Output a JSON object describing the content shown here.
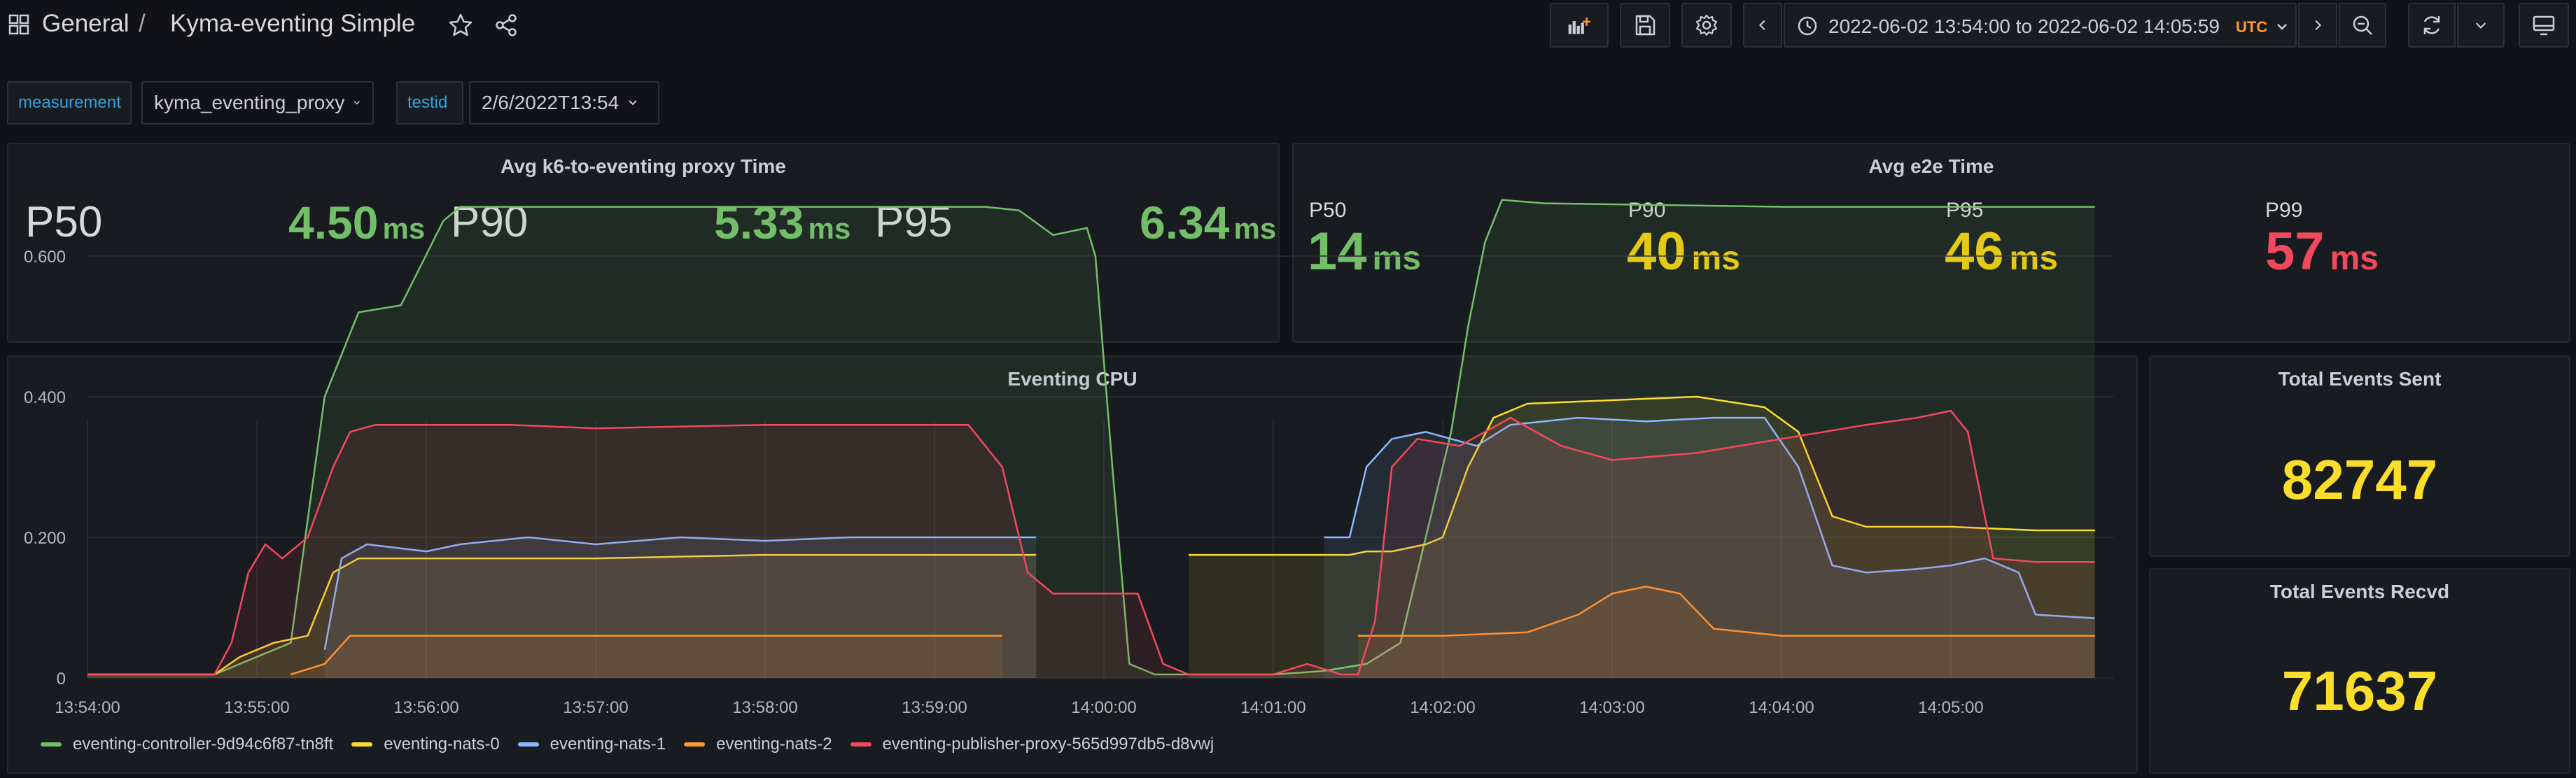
{
  "header": {
    "folder": "General",
    "separator": "/",
    "dashboard_title": "Kyma-eventing Simple",
    "time_range": "2022-06-02 13:54:00 to 2022-06-02 14:05:59",
    "timezone": "UTC"
  },
  "variables": [
    {
      "label": "measurement",
      "value": "kyma_eventing_proxy"
    },
    {
      "label": "testid",
      "value": "2/6/2022T13:54"
    }
  ],
  "proxy_panel": {
    "title": "Avg k6-to-eventing proxy Time",
    "stats": [
      {
        "label": "P50",
        "value": "4.50",
        "unit": "ms"
      },
      {
        "label": "P90",
        "value": "5.33",
        "unit": "ms"
      },
      {
        "label": "P95",
        "value": "6.34",
        "unit": "ms"
      }
    ]
  },
  "e2e_panel": {
    "title": "Avg e2e Time",
    "stats": [
      {
        "label": "P50",
        "value": "14",
        "unit": "ms",
        "color": "#73bf69"
      },
      {
        "label": "P90",
        "value": "40",
        "unit": "ms",
        "color": "#f2cc0c"
      },
      {
        "label": "P95",
        "value": "46",
        "unit": "ms",
        "color": "#f2cc0c"
      },
      {
        "label": "P99",
        "value": "57",
        "unit": "ms",
        "color": "#f2495c"
      }
    ]
  },
  "sent_panel": {
    "title": "Total Events Sent",
    "value": "82747"
  },
  "recvd_panel": {
    "title": "Total Events Recvd",
    "value": "71637"
  },
  "cpu_panel": {
    "title": "Eventing CPU"
  },
  "chart_data": {
    "type": "area",
    "title": "Eventing CPU",
    "x_tick_labels": [
      "13:54:00",
      "13:55:00",
      "13:56:00",
      "13:57:00",
      "13:58:00",
      "13:59:00",
      "14:00:00",
      "14:01:00",
      "14:02:00",
      "14:03:00",
      "14:04:00",
      "14:05:00"
    ],
    "y_tick_labels": [
      "0",
      "0.200",
      "0.400",
      "0.600"
    ],
    "xlim_minutes": [
      0,
      12.25
    ],
    "ylim": [
      0,
      0.73
    ],
    "grid": true,
    "legend_position": "bottom",
    "series": [
      {
        "name": "eventing-controller-9d94c6f87-tn8ft",
        "color": "#73bf69",
        "points": [
          [
            0,
            0.005
          ],
          [
            0.75,
            0.005
          ],
          [
            0.9,
            0.02
          ],
          [
            1.2,
            0.05
          ],
          [
            1.4,
            0.4
          ],
          [
            1.6,
            0.52
          ],
          [
            1.85,
            0.53
          ],
          [
            2.1,
            0.65
          ],
          [
            2.2,
            0.67
          ],
          [
            3.0,
            0.67
          ],
          [
            5.0,
            0.67
          ],
          [
            5.3,
            0.67
          ],
          [
            5.5,
            0.665
          ],
          [
            5.7,
            0.63
          ],
          [
            5.9,
            0.64
          ],
          [
            5.95,
            0.6
          ],
          [
            6.05,
            0.3
          ],
          [
            6.15,
            0.02
          ],
          [
            6.3,
            0.005
          ],
          [
            7.0,
            0.005
          ],
          [
            7.3,
            0.01
          ],
          [
            7.55,
            0.02
          ],
          [
            7.75,
            0.05
          ],
          [
            7.9,
            0.2
          ],
          [
            8.05,
            0.35
          ],
          [
            8.15,
            0.5
          ],
          [
            8.25,
            0.62
          ],
          [
            8.35,
            0.68
          ],
          [
            8.6,
            0.675
          ],
          [
            10.0,
            0.67
          ],
          [
            11.5,
            0.67
          ],
          [
            11.85,
            0.67
          ]
        ]
      },
      {
        "name": "eventing-nats-0",
        "color": "#fade2a",
        "points": [
          [
            0,
            0.005
          ],
          [
            0.75,
            0.005
          ],
          [
            0.9,
            0.03
          ],
          [
            1.1,
            0.05
          ],
          [
            1.3,
            0.06
          ],
          [
            1.45,
            0.15
          ],
          [
            1.6,
            0.17
          ],
          [
            2.0,
            0.17
          ],
          [
            3.0,
            0.17
          ],
          [
            4.0,
            0.175
          ],
          [
            5.0,
            0.175
          ],
          [
            5.6,
            0.175
          ],
          [
            null,
            null
          ],
          [
            6.5,
            0.175
          ],
          [
            7.45,
            0.175
          ],
          [
            7.55,
            0.18
          ],
          [
            7.7,
            0.18
          ],
          [
            7.9,
            0.19
          ],
          [
            8.0,
            0.2
          ],
          [
            8.15,
            0.3
          ],
          [
            8.3,
            0.37
          ],
          [
            8.5,
            0.39
          ],
          [
            9.0,
            0.395
          ],
          [
            9.5,
            0.4
          ],
          [
            9.9,
            0.385
          ],
          [
            10.1,
            0.35
          ],
          [
            10.3,
            0.23
          ],
          [
            10.5,
            0.215
          ],
          [
            11.0,
            0.215
          ],
          [
            11.5,
            0.21
          ],
          [
            11.85,
            0.21
          ]
        ]
      },
      {
        "name": "eventing-nats-1",
        "color": "#8ab8ff",
        "points": [
          [
            1.4,
            0.04
          ],
          [
            1.5,
            0.17
          ],
          [
            1.65,
            0.19
          ],
          [
            2.0,
            0.18
          ],
          [
            2.2,
            0.19
          ],
          [
            2.6,
            0.2
          ],
          [
            3.0,
            0.19
          ],
          [
            3.5,
            0.2
          ],
          [
            4.0,
            0.195
          ],
          [
            4.5,
            0.2
          ],
          [
            5.0,
            0.2
          ],
          [
            5.6,
            0.2
          ],
          [
            null,
            null
          ],
          [
            7.3,
            0.2
          ],
          [
            7.45,
            0.2
          ],
          [
            7.55,
            0.3
          ],
          [
            7.7,
            0.34
          ],
          [
            7.9,
            0.35
          ],
          [
            8.2,
            0.33
          ],
          [
            8.4,
            0.36
          ],
          [
            8.8,
            0.37
          ],
          [
            9.2,
            0.365
          ],
          [
            9.6,
            0.37
          ],
          [
            9.9,
            0.37
          ],
          [
            10.1,
            0.3
          ],
          [
            10.3,
            0.16
          ],
          [
            10.5,
            0.15
          ],
          [
            10.8,
            0.155
          ],
          [
            11.0,
            0.16
          ],
          [
            11.2,
            0.17
          ],
          [
            11.4,
            0.15
          ],
          [
            11.5,
            0.09
          ],
          [
            11.85,
            0.085
          ]
        ]
      },
      {
        "name": "eventing-nats-2",
        "color": "#ff9830",
        "points": [
          [
            1.2,
            0.005
          ],
          [
            1.4,
            0.02
          ],
          [
            1.55,
            0.06
          ],
          [
            1.8,
            0.06
          ],
          [
            3.0,
            0.06
          ],
          [
            4.0,
            0.06
          ],
          [
            5.4,
            0.06
          ],
          [
            null,
            null
          ],
          [
            7.5,
            0.06
          ],
          [
            8.0,
            0.06
          ],
          [
            8.5,
            0.065
          ],
          [
            8.8,
            0.09
          ],
          [
            9.0,
            0.12
          ],
          [
            9.2,
            0.13
          ],
          [
            9.4,
            0.12
          ],
          [
            9.6,
            0.07
          ],
          [
            10.0,
            0.06
          ],
          [
            11.0,
            0.06
          ],
          [
            11.85,
            0.06
          ]
        ]
      },
      {
        "name": "eventing-publisher-proxy-565d997db5-d8vwj",
        "color": "#f2495c",
        "points": [
          [
            0,
            0.005
          ],
          [
            0.75,
            0.005
          ],
          [
            0.85,
            0.05
          ],
          [
            0.95,
            0.15
          ],
          [
            1.05,
            0.19
          ],
          [
            1.15,
            0.17
          ],
          [
            1.3,
            0.2
          ],
          [
            1.45,
            0.3
          ],
          [
            1.55,
            0.35
          ],
          [
            1.7,
            0.36
          ],
          [
            2.5,
            0.36
          ],
          [
            3.0,
            0.355
          ],
          [
            4.0,
            0.36
          ],
          [
            5.2,
            0.36
          ],
          [
            5.4,
            0.3
          ],
          [
            5.55,
            0.15
          ],
          [
            5.7,
            0.12
          ],
          [
            6.0,
            0.12
          ],
          [
            6.2,
            0.12
          ],
          [
            6.35,
            0.02
          ],
          [
            6.5,
            0.005
          ],
          [
            7.0,
            0.005
          ],
          [
            7.2,
            0.02
          ],
          [
            7.4,
            0.005
          ],
          [
            7.5,
            0.005
          ],
          [
            7.6,
            0.08
          ],
          [
            7.7,
            0.3
          ],
          [
            7.85,
            0.34
          ],
          [
            8.1,
            0.33
          ],
          [
            8.4,
            0.37
          ],
          [
            8.7,
            0.33
          ],
          [
            9.0,
            0.31
          ],
          [
            9.5,
            0.32
          ],
          [
            10.0,
            0.34
          ],
          [
            10.5,
            0.36
          ],
          [
            10.8,
            0.37
          ],
          [
            11.0,
            0.38
          ],
          [
            11.1,
            0.35
          ],
          [
            11.25,
            0.17
          ],
          [
            11.5,
            0.165
          ],
          [
            11.85,
            0.165
          ]
        ]
      }
    ]
  }
}
